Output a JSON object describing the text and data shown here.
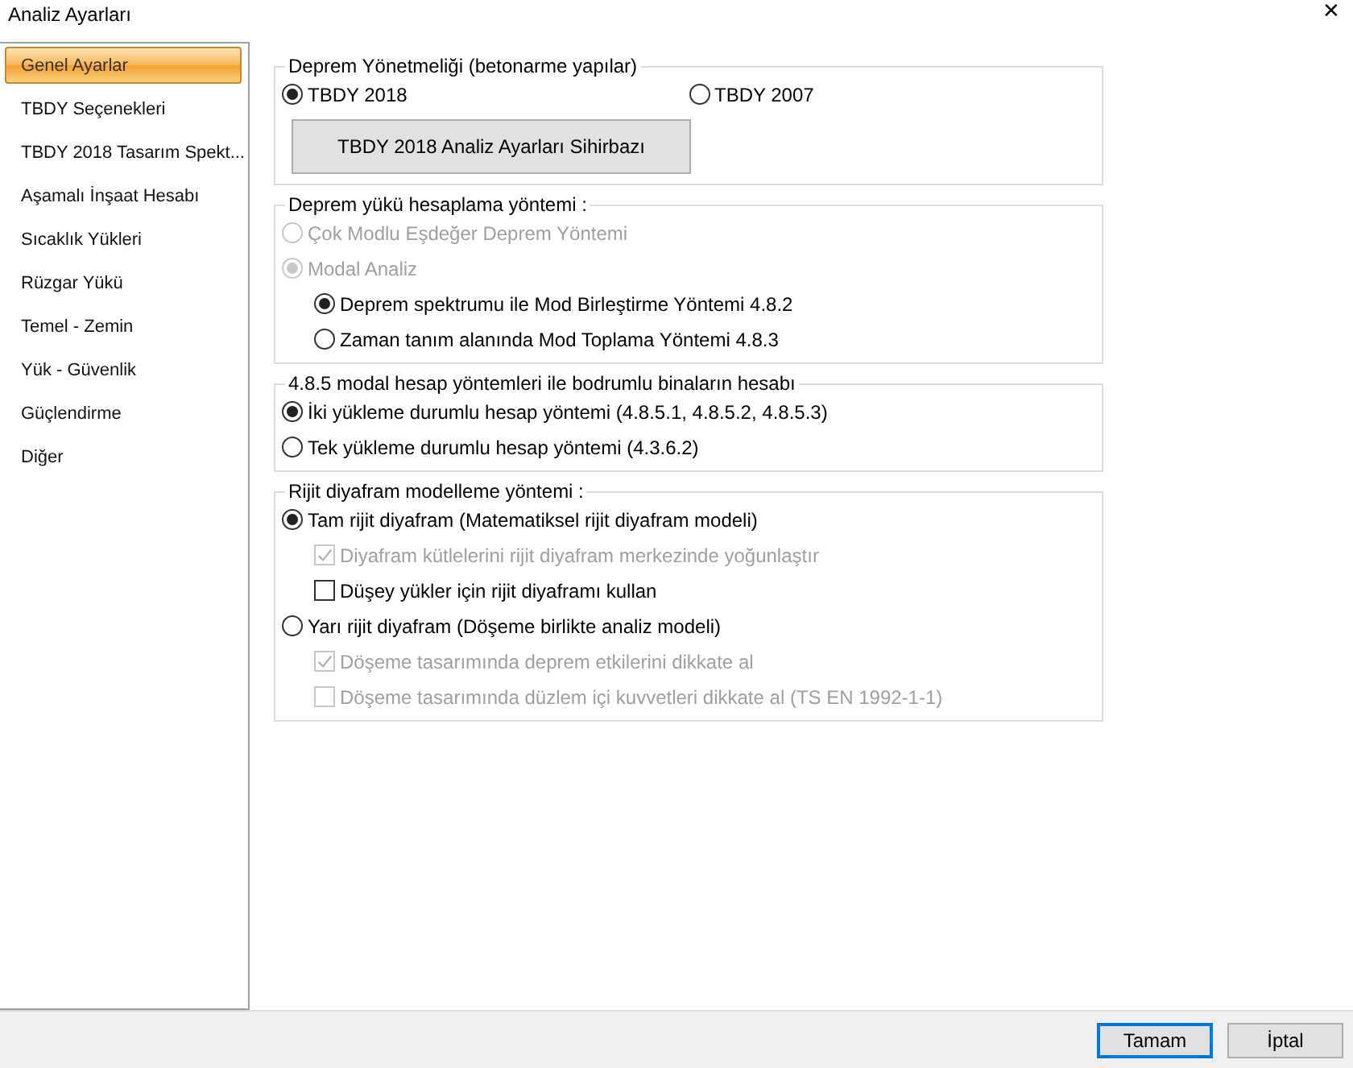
{
  "window": {
    "title": "Analiz Ayarları",
    "close": "✕"
  },
  "sidebar": {
    "items": [
      {
        "label": "Genel Ayarlar",
        "selected": true
      },
      {
        "label": "TBDY Seçenekleri",
        "selected": false
      },
      {
        "label": "TBDY 2018 Tasarım Spekt...",
        "selected": false
      },
      {
        "label": "Aşamalı İnşaat Hesabı",
        "selected": false
      },
      {
        "label": "Sıcaklık Yükleri",
        "selected": false
      },
      {
        "label": "Rüzgar Yükü",
        "selected": false
      },
      {
        "label": "Temel - Zemin",
        "selected": false
      },
      {
        "label": "Yük - Güvenlik",
        "selected": false
      },
      {
        "label": "Güçlendirme",
        "selected": false
      },
      {
        "label": "Diğer",
        "selected": false
      }
    ]
  },
  "groups": [
    {
      "title": "Deprem Yönetmeliği (betonarme yapılar)",
      "items": [
        {
          "kind": "radio_row",
          "options": [
            {
              "label": "TBDY 2018",
              "selected": true
            },
            {
              "label": "TBDY 2007",
              "selected": false
            }
          ]
        },
        {
          "kind": "button",
          "label": "TBDY 2018 Analiz Ayarları Sihirbazı"
        }
      ]
    },
    {
      "title": "Deprem yükü hesaplama yöntemi :",
      "items": [
        {
          "kind": "radio",
          "label": "Çok Modlu Eşdeğer Deprem Yöntemi",
          "selected": false,
          "disabled": true
        },
        {
          "kind": "radio",
          "label": "Modal Analiz",
          "selected": true,
          "disabled": true,
          "children": [
            {
              "kind": "radio",
              "label": "Deprem spektrumu ile Mod Birleştirme Yöntemi 4.8.2",
              "selected": true,
              "disabled": false
            },
            {
              "kind": "radio",
              "label": "Zaman tanım alanında Mod Toplama Yöntemi 4.8.3",
              "selected": false,
              "disabled": false
            }
          ]
        }
      ]
    },
    {
      "title": "4.8.5 modal hesap yöntemleri ile bodrumlu binaların hesabı",
      "items": [
        {
          "kind": "radio",
          "label": "İki yükleme durumlu hesap yöntemi (4.8.5.1, 4.8.5.2, 4.8.5.3)",
          "selected": true,
          "disabled": false
        },
        {
          "kind": "radio",
          "label": "Tek yükleme durumlu hesap yöntemi (4.3.6.2)",
          "selected": false,
          "disabled": false
        }
      ]
    },
    {
      "title": "Rijit diyafram modelleme yöntemi  :",
      "items": [
        {
          "kind": "radio",
          "label": "Tam rijit diyafram (Matematiksel rijit diyafram modeli)",
          "selected": true,
          "disabled": false,
          "children": [
            {
              "kind": "checkbox",
              "label": "Diyafram kütlelerini rijit diyafram merkezinde yoğunlaştır",
              "checked": true,
              "disabled": true
            },
            {
              "kind": "checkbox",
              "label": "Düşey yükler için rijit diyaframı kullan",
              "checked": false,
              "disabled": false
            }
          ]
        },
        {
          "kind": "radio",
          "label": "Yarı rijit diyafram (Döşeme birlikte analiz modeli)",
          "selected": false,
          "disabled": false,
          "children": [
            {
              "kind": "checkbox",
              "label": "Döşeme tasarımında deprem etkilerini dikkate al",
              "checked": true,
              "disabled": true
            },
            {
              "kind": "checkbox",
              "label": "Döşeme tasarımında düzlem içi kuvvetleri dikkate al (TS EN 1992-1-1)",
              "checked": false,
              "disabled": true
            }
          ]
        }
      ]
    }
  ],
  "buttons": [
    {
      "label": "Tamam",
      "default": true
    },
    {
      "label": "İptal",
      "default": false
    }
  ]
}
